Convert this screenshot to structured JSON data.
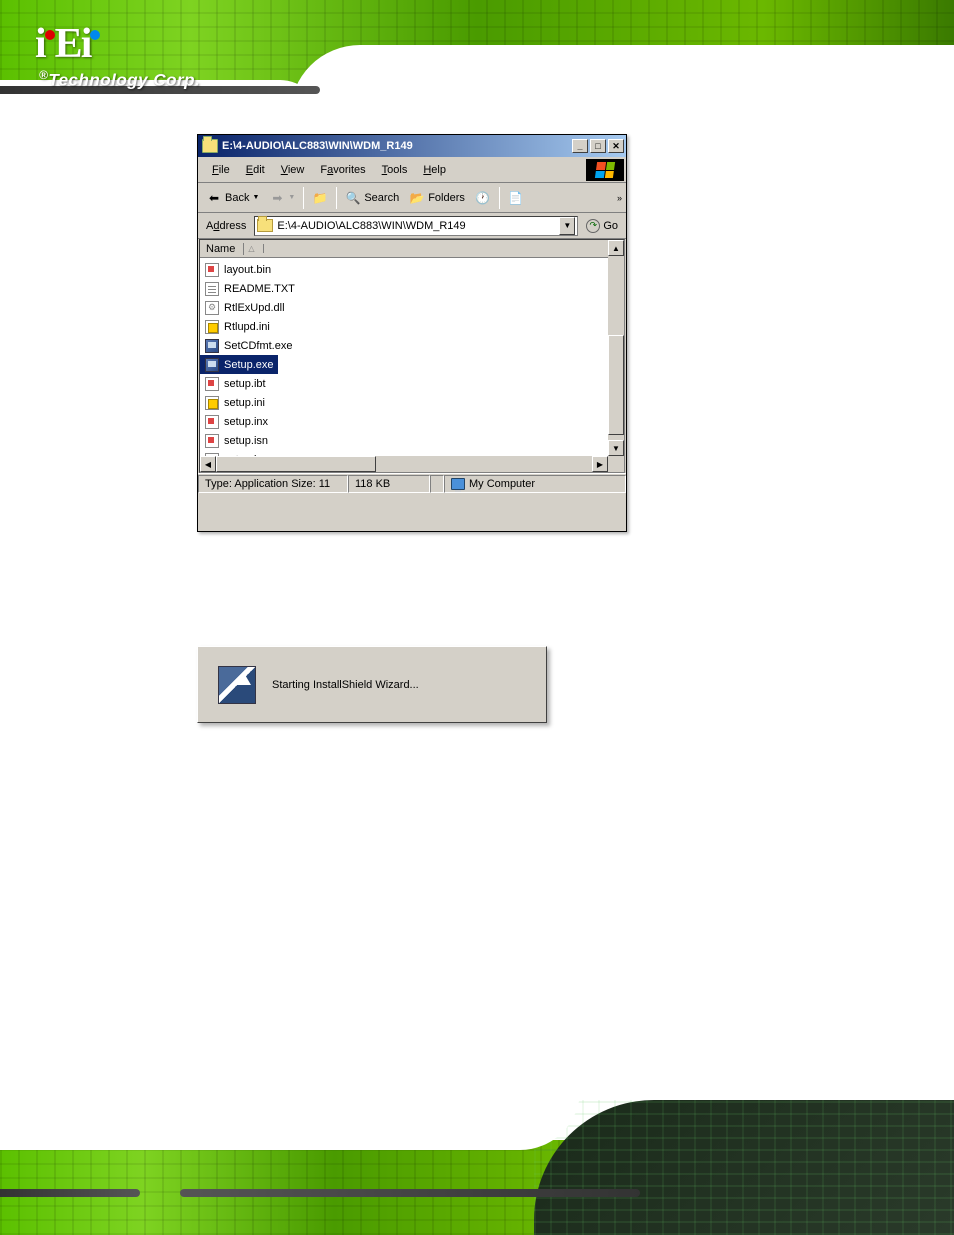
{
  "branding": {
    "logo": "iEi",
    "tagline": "Technology Corp."
  },
  "explorer": {
    "title": "E:\\4-AUDIO\\ALC883\\WIN\\WDM_R149",
    "menu": [
      "File",
      "Edit",
      "View",
      "Favorites",
      "Tools",
      "Help"
    ],
    "toolbar": {
      "back": "Back",
      "search": "Search",
      "folders": "Folders"
    },
    "address": {
      "label": "Address",
      "path": "E:\\4-AUDIO\\ALC883\\WIN\\WDM_R149",
      "go": "Go"
    },
    "column_header": "Name",
    "files": [
      {
        "name": "layout.bin",
        "icon": "bin"
      },
      {
        "name": "README.TXT",
        "icon": "txt"
      },
      {
        "name": "RtlExUpd.dll",
        "icon": "dll"
      },
      {
        "name": "Rtlupd.ini",
        "icon": "ini"
      },
      {
        "name": "SetCDfmt.exe",
        "icon": "exe"
      },
      {
        "name": "Setup.exe",
        "icon": "exe",
        "selected": true
      },
      {
        "name": "setup.ibt",
        "icon": "bin"
      },
      {
        "name": "setup.ini",
        "icon": "ini"
      },
      {
        "name": "setup.inx",
        "icon": "bin"
      },
      {
        "name": "setup.isn",
        "icon": "bin"
      },
      {
        "name": "setup.iss",
        "icon": "bin"
      }
    ],
    "status": {
      "type": "Type: Application Size: 11",
      "size": "118 KB",
      "location": "My Computer"
    }
  },
  "installshield": {
    "text": "Starting InstallShield Wizard..."
  }
}
